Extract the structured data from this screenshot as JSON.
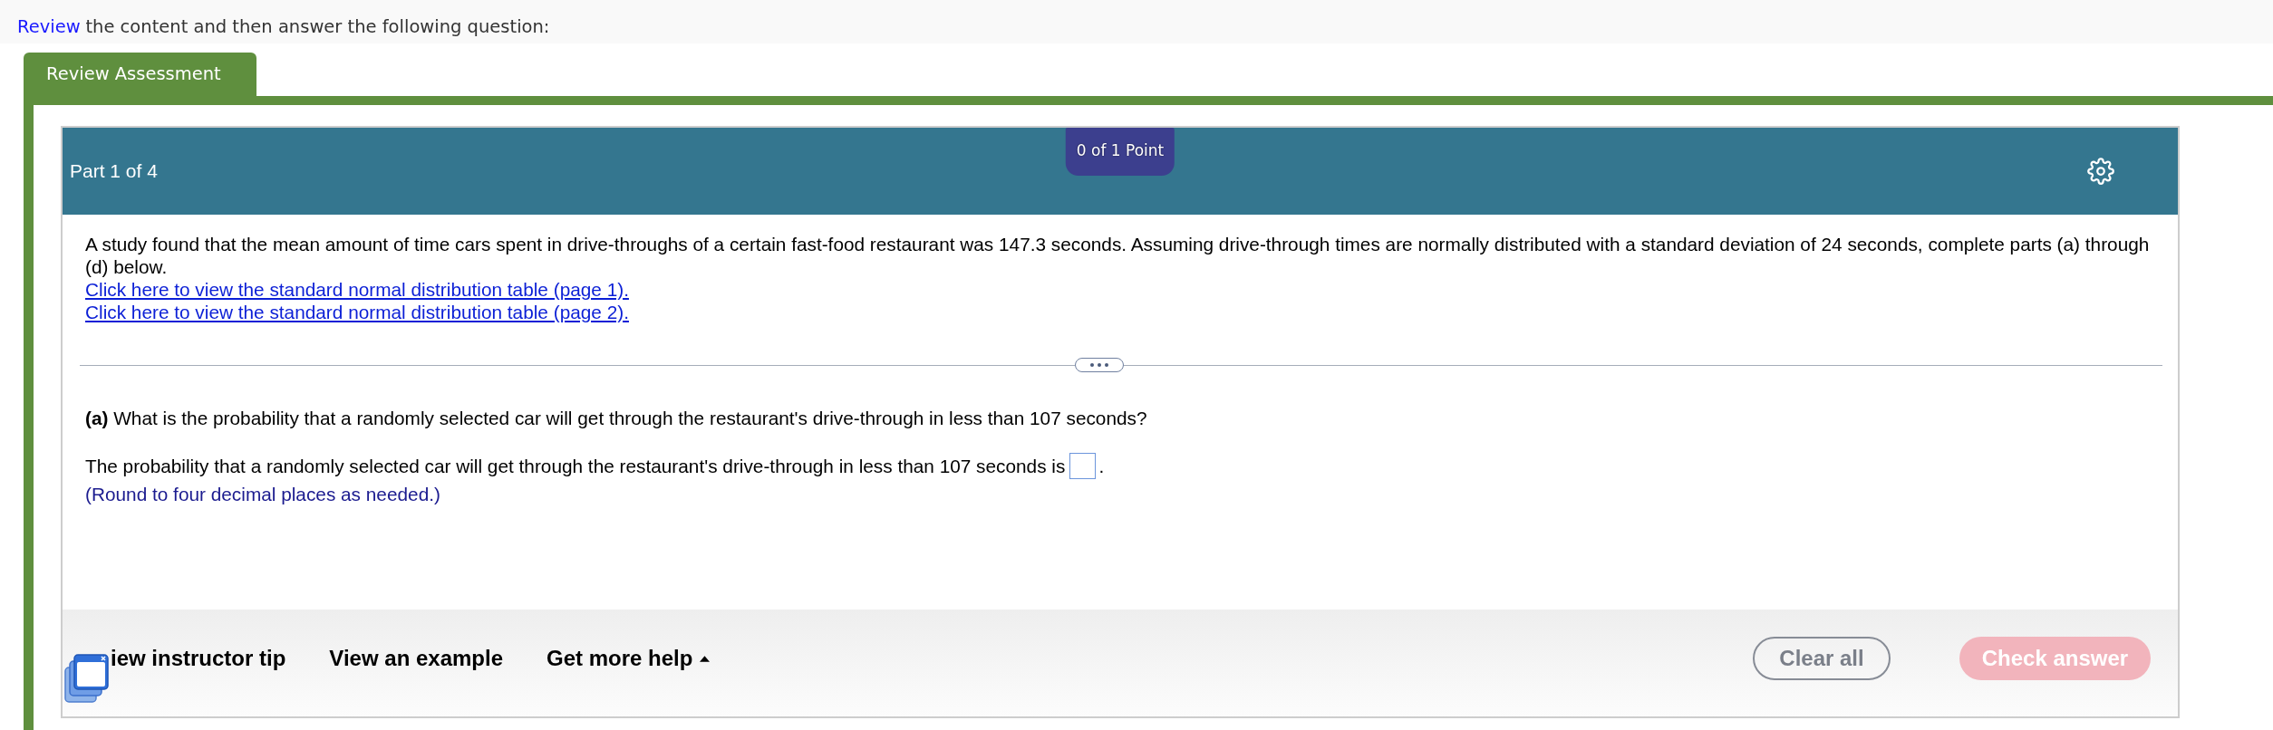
{
  "instruction": {
    "link": "Review",
    "text": "the content and then answer the following question:"
  },
  "tabs": [
    {
      "label": "Review Assessment",
      "selected": true
    }
  ],
  "panel": {
    "header": {
      "part": "Part 1 of 4",
      "score": "0 of 1 Point"
    },
    "intro": {
      "text": "A study found that the mean amount of time cars spent in drive-throughs of a certain fast-food restaurant was 147.3 seconds. Assuming drive-through times are normally distributed with a standard deviation of 24 seconds, complete parts (a) through (d) below.",
      "links": [
        "Click here to view the standard normal distribution table (page 1).",
        "Click here to view the standard normal distribution table (page 2)."
      ]
    },
    "part_a": {
      "question": "**(a)** What is the probability that a randomly selected car will get through the restaurant's drive-through in less than 107 seconds?",
      "answer_prefix": "The probability that a randomly selected car will get through the restaurant's drive-through in less than 107 seconds is",
      "answer_suffix": ".",
      "hint": "(Round to four decimal places as needed.)"
    }
  },
  "toolbar": {
    "help_links": [
      {
        "label": "iew instructor tip",
        "kind": "link"
      },
      {
        "label": "View an example",
        "kind": "link"
      },
      {
        "label": "Get more help",
        "kind": "menu"
      }
    ],
    "actions": [
      {
        "label": "Clear all",
        "disabled": false
      },
      {
        "label": "Check answer",
        "disabled": true
      }
    ]
  }
}
